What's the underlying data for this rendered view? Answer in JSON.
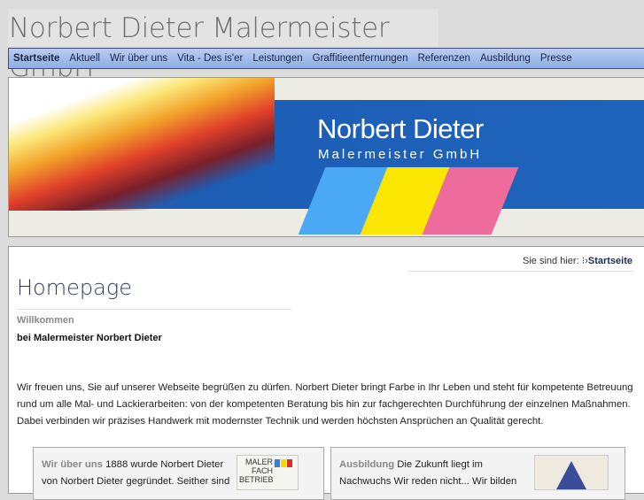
{
  "site_title": "Norbert Dieter Malermeister GmbH",
  "nav": [
    "Startseite",
    "Aktuell",
    "Wir über uns",
    "Vita - Des is'er",
    "Leistungen",
    "Graffitieentfernungen",
    "Referenzen",
    "Ausbildung",
    "Presse"
  ],
  "banner": {
    "name": "Norbert Dieter",
    "subtitle": "Malermeister  GmbH"
  },
  "breadcrumb": {
    "label": "Sie sind hier:",
    "current": "Startseite"
  },
  "heading": "Homepage",
  "welcome": "Willkommen",
  "subheading": "bei Malermeister Norbert Dieter",
  "intro": "Wir freuen uns, Sie auf unserer Webseite begrüßen zu dürfen. Norbert Dieter bringt Farbe in Ihr Leben und steht für kompetente Betreuung rund um alle Mal- und Lackierarbeiten: von der kompetenten Beratung bis hin zur fachgerechten Durchführung der einzelnen Maßnahmen. Dabei verbinden wir präzises Handwerk mit modernster Technik und werden höchsten Ansprüchen an Qualität gerecht.",
  "teasers": [
    {
      "label": "Wir über uns",
      "text": " 1888 wurde Norbert Dieter von Norbert Dieter gegründet. Seither sind",
      "logo": "MALER FACH BETRIEB"
    },
    {
      "label": "Ausbildung",
      "text": " Die Zukunft liegt im Nachwuchs Wir reden nicht... Wir bilden"
    }
  ]
}
